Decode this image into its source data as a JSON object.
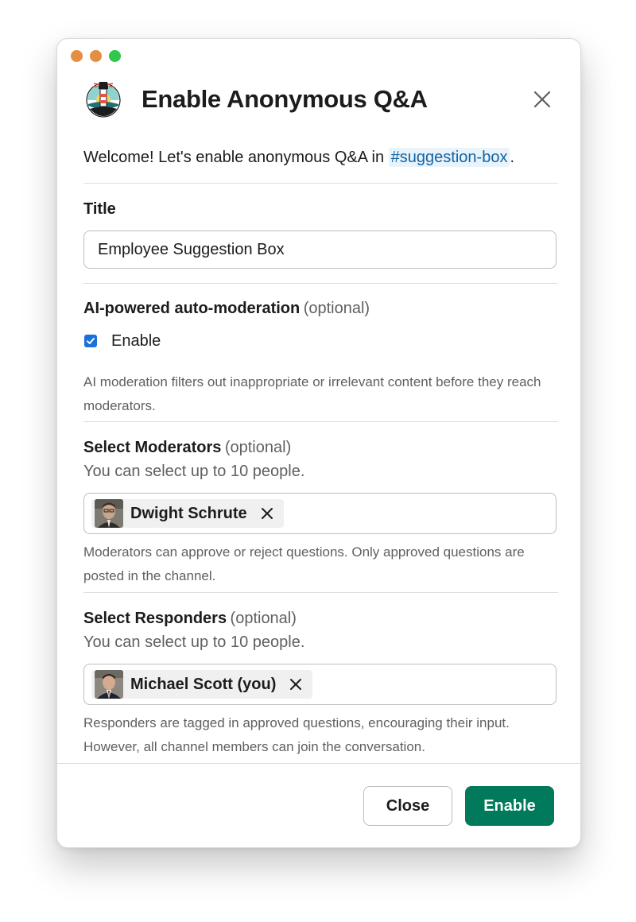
{
  "window": {
    "controls": [
      "close",
      "minimize",
      "maximize"
    ],
    "title": "Enable Anonymous Q&A"
  },
  "intro": {
    "text_before": "Welcome! Let's enable anonymous Q&A in ",
    "channel": "#suggestion-box",
    "text_after": "."
  },
  "title_field": {
    "label": "Title",
    "value": "Employee Suggestion Box"
  },
  "moderation": {
    "label": "AI-powered auto-moderation",
    "optional": "(optional)",
    "checkbox_label": "Enable",
    "checked": true,
    "help": "AI moderation filters out inappropriate or irrelevant content before they reach moderators."
  },
  "moderators": {
    "label": "Select Moderators",
    "optional": "(optional)",
    "subtitle": "You can select up to 10 people.",
    "selected": [
      {
        "name": "Dwight Schrute"
      }
    ],
    "help": "Moderators can approve or reject questions. Only approved questions are posted in the channel."
  },
  "responders": {
    "label": "Select Responders",
    "optional": "(optional)",
    "subtitle": "You can select up to 10 people.",
    "selected": [
      {
        "name": "Michael Scott (you)"
      }
    ],
    "help": "Responders are tagged in approved questions, encouraging their input. However, all channel members can join the conversation."
  },
  "footer": {
    "close_label": "Close",
    "enable_label": "Enable"
  },
  "colors": {
    "accent_link": "#1264a3",
    "checkbox": "#1d6fd9",
    "primary_button": "#007a5a",
    "traffic_close": "#e58d43",
    "traffic_minimize": "#e58d43",
    "traffic_maximize": "#2fc84a"
  },
  "icons": [
    "lighthouse-app-icon",
    "close-icon",
    "checkmark-icon",
    "remove-icon"
  ]
}
